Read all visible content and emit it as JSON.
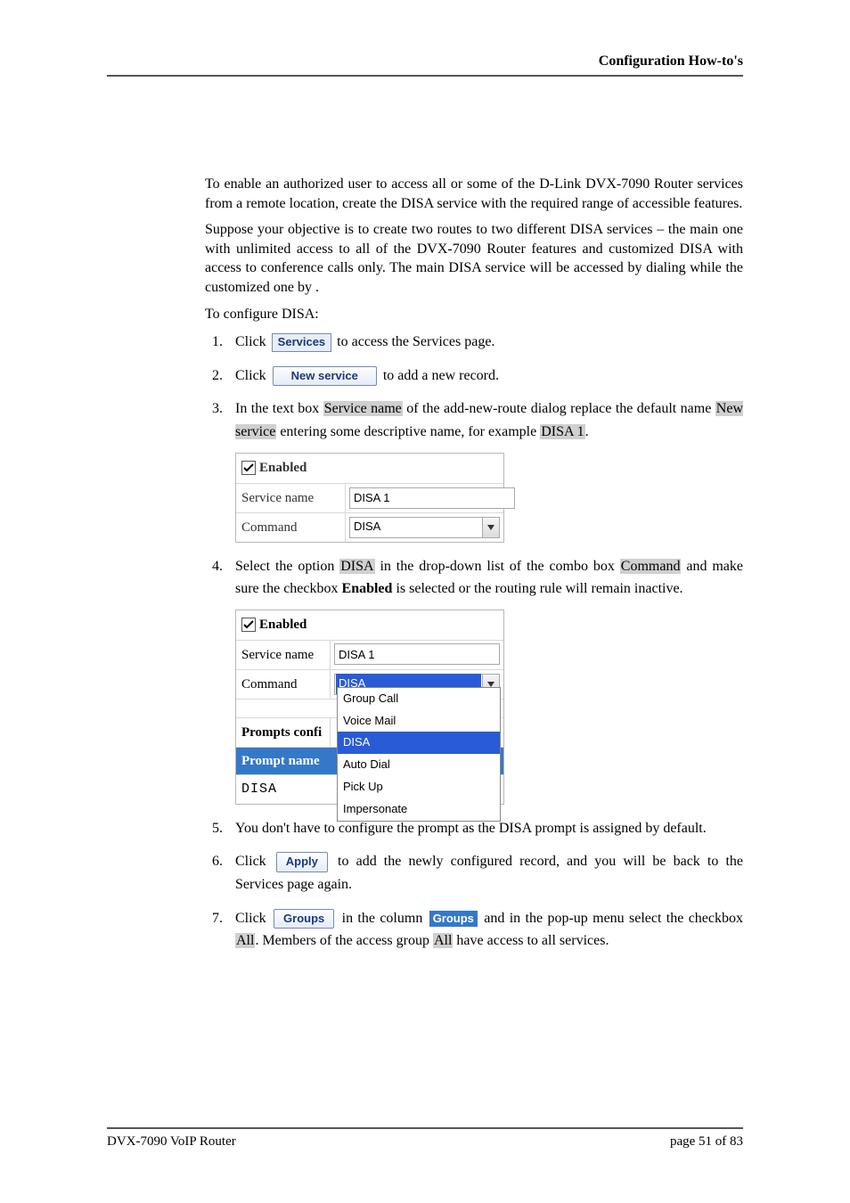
{
  "header": {
    "title": "Configuration How-to's"
  },
  "intro1": "To enable an authorized user to access all or some of the D-Link DVX-7090 Router services from a remote location, create the DISA service with the required range of accessible features.",
  "intro2": "Suppose your objective is to create two routes to two different DISA services – the main one with unlimited access to all of the DVX-7090 Router features and customized DISA with access to conference calls only. The main DISA service will be accessed by dialing          while the customized one by        .",
  "intro3": "To configure DISA:",
  "step1": {
    "pre": "Click ",
    "btn": "Services",
    "post": " to access the Services page."
  },
  "step2": {
    "pre": "Click ",
    "btn": "New service",
    "post": " to add a new record."
  },
  "step3": {
    "pre": "In the text box ",
    "hl1": "Service name",
    "mid": " of the add-new-route dialog replace the default name ",
    "hl2": "New service",
    "post1": " entering some descriptive name, for example ",
    "hl3": "DISA 1",
    "tail": "."
  },
  "panel1": {
    "enabled_label": "Enabled",
    "service_name_label": "Service name",
    "service_name_value": "DISA 1",
    "command_label": "Command",
    "command_value": "DISA"
  },
  "step4": {
    "pre": "Select the option ",
    "hl1": "DISA",
    "mid1": " in the drop-down list of the combo box ",
    "hl2": "Command",
    "mid2": " and make sure the checkbox ",
    "b1": "Enabled",
    "post": " is selected or the routing rule will remain inactive."
  },
  "panel2": {
    "enabled_label": "Enabled",
    "service_name_label": "Service name",
    "service_name_value": "DISA 1",
    "command_label": "Command",
    "command_value": "DISA",
    "prompts_confi_label": "Prompts confi",
    "prompt_name_label": "Prompt name",
    "disa_text": "DISA",
    "options": [
      "Group Call",
      "Voice Mail",
      "DISA",
      "Auto Dial",
      "Pick Up",
      "Impersonate"
    ],
    "selected_index": 2
  },
  "step5": "You don't have to configure the prompt as the DISA prompt is assigned by default.",
  "step6": {
    "pre": "Click ",
    "btn": "Apply",
    "post": " to add the newly configured record, and you will be back to the Services page again."
  },
  "step7": {
    "pre": "Click ",
    "btn": "Groups",
    "mid1": " in the column ",
    "head": "Groups",
    "mid2": " and in the pop-up menu select the checkbox ",
    "hl1": "All",
    "mid3": ". Members of the access group ",
    "hl2": "All",
    "post": " have access to all services."
  },
  "footer": {
    "left": "DVX-7090 VoIP Router",
    "right": "page 51 of 83"
  }
}
